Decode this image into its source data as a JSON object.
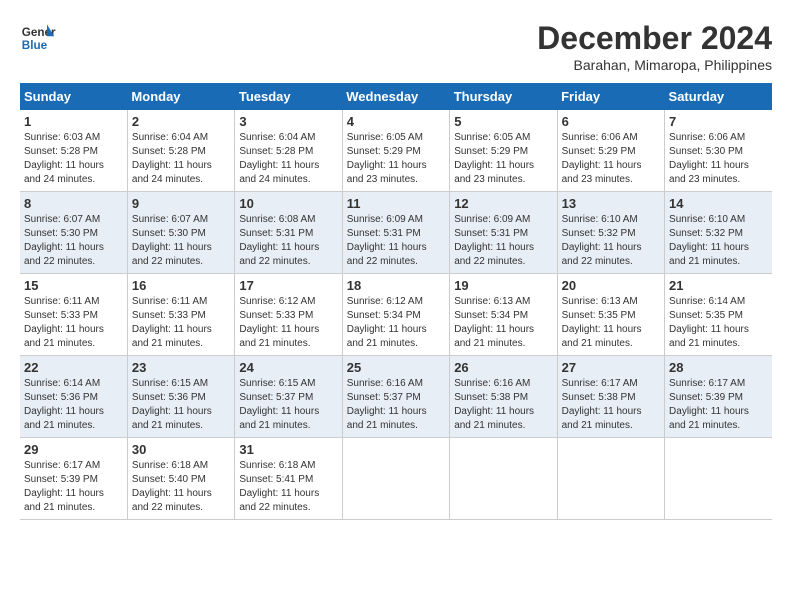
{
  "logo": {
    "line1": "General",
    "line2": "Blue"
  },
  "title": "December 2024",
  "subtitle": "Barahan, Mimaropa, Philippines",
  "days_of_week": [
    "Sunday",
    "Monday",
    "Tuesday",
    "Wednesday",
    "Thursday",
    "Friday",
    "Saturday"
  ],
  "weeks": [
    [
      {
        "day": "1",
        "sunrise": "6:03 AM",
        "sunset": "5:28 PM",
        "daylight": "11 hours and 24 minutes."
      },
      {
        "day": "2",
        "sunrise": "6:04 AM",
        "sunset": "5:28 PM",
        "daylight": "11 hours and 24 minutes."
      },
      {
        "day": "3",
        "sunrise": "6:04 AM",
        "sunset": "5:28 PM",
        "daylight": "11 hours and 24 minutes."
      },
      {
        "day": "4",
        "sunrise": "6:05 AM",
        "sunset": "5:29 PM",
        "daylight": "11 hours and 23 minutes."
      },
      {
        "day": "5",
        "sunrise": "6:05 AM",
        "sunset": "5:29 PM",
        "daylight": "11 hours and 23 minutes."
      },
      {
        "day": "6",
        "sunrise": "6:06 AM",
        "sunset": "5:29 PM",
        "daylight": "11 hours and 23 minutes."
      },
      {
        "day": "7",
        "sunrise": "6:06 AM",
        "sunset": "5:30 PM",
        "daylight": "11 hours and 23 minutes."
      }
    ],
    [
      {
        "day": "8",
        "sunrise": "6:07 AM",
        "sunset": "5:30 PM",
        "daylight": "11 hours and 22 minutes."
      },
      {
        "day": "9",
        "sunrise": "6:07 AM",
        "sunset": "5:30 PM",
        "daylight": "11 hours and 22 minutes."
      },
      {
        "day": "10",
        "sunrise": "6:08 AM",
        "sunset": "5:31 PM",
        "daylight": "11 hours and 22 minutes."
      },
      {
        "day": "11",
        "sunrise": "6:09 AM",
        "sunset": "5:31 PM",
        "daylight": "11 hours and 22 minutes."
      },
      {
        "day": "12",
        "sunrise": "6:09 AM",
        "sunset": "5:31 PM",
        "daylight": "11 hours and 22 minutes."
      },
      {
        "day": "13",
        "sunrise": "6:10 AM",
        "sunset": "5:32 PM",
        "daylight": "11 hours and 22 minutes."
      },
      {
        "day": "14",
        "sunrise": "6:10 AM",
        "sunset": "5:32 PM",
        "daylight": "11 hours and 21 minutes."
      }
    ],
    [
      {
        "day": "15",
        "sunrise": "6:11 AM",
        "sunset": "5:33 PM",
        "daylight": "11 hours and 21 minutes."
      },
      {
        "day": "16",
        "sunrise": "6:11 AM",
        "sunset": "5:33 PM",
        "daylight": "11 hours and 21 minutes."
      },
      {
        "day": "17",
        "sunrise": "6:12 AM",
        "sunset": "5:33 PM",
        "daylight": "11 hours and 21 minutes."
      },
      {
        "day": "18",
        "sunrise": "6:12 AM",
        "sunset": "5:34 PM",
        "daylight": "11 hours and 21 minutes."
      },
      {
        "day": "19",
        "sunrise": "6:13 AM",
        "sunset": "5:34 PM",
        "daylight": "11 hours and 21 minutes."
      },
      {
        "day": "20",
        "sunrise": "6:13 AM",
        "sunset": "5:35 PM",
        "daylight": "11 hours and 21 minutes."
      },
      {
        "day": "21",
        "sunrise": "6:14 AM",
        "sunset": "5:35 PM",
        "daylight": "11 hours and 21 minutes."
      }
    ],
    [
      {
        "day": "22",
        "sunrise": "6:14 AM",
        "sunset": "5:36 PM",
        "daylight": "11 hours and 21 minutes."
      },
      {
        "day": "23",
        "sunrise": "6:15 AM",
        "sunset": "5:36 PM",
        "daylight": "11 hours and 21 minutes."
      },
      {
        "day": "24",
        "sunrise": "6:15 AM",
        "sunset": "5:37 PM",
        "daylight": "11 hours and 21 minutes."
      },
      {
        "day": "25",
        "sunrise": "6:16 AM",
        "sunset": "5:37 PM",
        "daylight": "11 hours and 21 minutes."
      },
      {
        "day": "26",
        "sunrise": "6:16 AM",
        "sunset": "5:38 PM",
        "daylight": "11 hours and 21 minutes."
      },
      {
        "day": "27",
        "sunrise": "6:17 AM",
        "sunset": "5:38 PM",
        "daylight": "11 hours and 21 minutes."
      },
      {
        "day": "28",
        "sunrise": "6:17 AM",
        "sunset": "5:39 PM",
        "daylight": "11 hours and 21 minutes."
      }
    ],
    [
      {
        "day": "29",
        "sunrise": "6:17 AM",
        "sunset": "5:39 PM",
        "daylight": "11 hours and 21 minutes."
      },
      {
        "day": "30",
        "sunrise": "6:18 AM",
        "sunset": "5:40 PM",
        "daylight": "11 hours and 22 minutes."
      },
      {
        "day": "31",
        "sunrise": "6:18 AM",
        "sunset": "5:41 PM",
        "daylight": "11 hours and 22 minutes."
      },
      {
        "day": "",
        "sunrise": "",
        "sunset": "",
        "daylight": ""
      },
      {
        "day": "",
        "sunrise": "",
        "sunset": "",
        "daylight": ""
      },
      {
        "day": "",
        "sunrise": "",
        "sunset": "",
        "daylight": ""
      },
      {
        "day": "",
        "sunrise": "",
        "sunset": "",
        "daylight": ""
      }
    ]
  ]
}
